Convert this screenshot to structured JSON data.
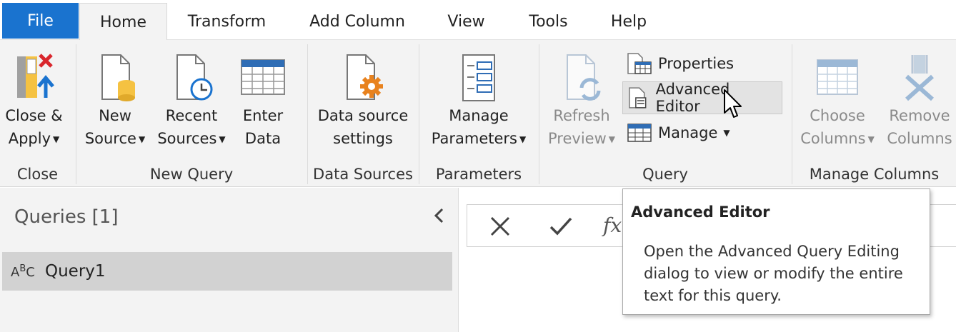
{
  "tabs": [
    "File",
    "Home",
    "Transform",
    "Add Column",
    "View",
    "Tools",
    "Help"
  ],
  "ribbon": {
    "close": {
      "group_label": "Close",
      "close_apply": {
        "line1": "Close &",
        "line2": "Apply"
      }
    },
    "new_query": {
      "group_label": "New Query",
      "new_source": {
        "line1": "New",
        "line2": "Source"
      },
      "recent_sources": {
        "line1": "Recent",
        "line2": "Sources"
      },
      "enter_data": {
        "line1": "Enter",
        "line2": "Data"
      }
    },
    "data_sources": {
      "group_label": "Data Sources",
      "settings": {
        "line1": "Data source",
        "line2": "settings"
      }
    },
    "parameters": {
      "group_label": "Parameters",
      "manage": {
        "line1": "Manage",
        "line2": "Parameters"
      }
    },
    "query": {
      "group_label": "Query",
      "refresh": {
        "line1": "Refresh",
        "line2": "Preview"
      },
      "properties": "Properties",
      "advanced_editor": "Advanced Editor",
      "manage": "Manage"
    },
    "manage_columns": {
      "group_label": "Manage Columns",
      "choose": {
        "line1": "Choose",
        "line2": "Columns"
      },
      "remove": {
        "line1": "Remove",
        "line2": "Columns"
      }
    }
  },
  "queries_pane": {
    "title": "Queries [1]",
    "items": [
      {
        "name": "Query1"
      }
    ]
  },
  "formula_bar": {
    "fx": "fx"
  },
  "tooltip": {
    "title": "Advanced Editor",
    "body": "Open the Advanced Query Editing dialog to view or modify the entire text for this query."
  },
  "colors": {
    "accent": "#1a73cf",
    "ribbon_bg": "#f3f3f3",
    "orange": "#e8821e",
    "yellow": "#f5c242",
    "red": "#d9262c"
  }
}
